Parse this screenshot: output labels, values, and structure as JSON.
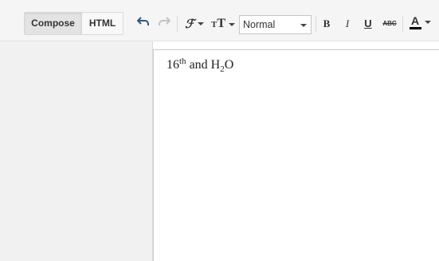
{
  "toolbar": {
    "compose_label": "Compose",
    "html_label": "HTML",
    "font_size_select": {
      "selected": "Normal"
    },
    "bold_label": "B",
    "italic_label": "I",
    "underline_label": "U",
    "strike_label": "ABC",
    "text_color_label": "A",
    "text_color": "#000000",
    "icons": [
      "undo-icon",
      "redo-icon",
      "font-family-icon",
      "font-size-icon",
      "bold-icon",
      "italic-icon",
      "underline-icon",
      "strikethrough-icon",
      "text-color-icon"
    ]
  },
  "editor": {
    "num": "16",
    "sup": "th",
    "mid": " and H",
    "sub": "2",
    "end": "O"
  }
}
